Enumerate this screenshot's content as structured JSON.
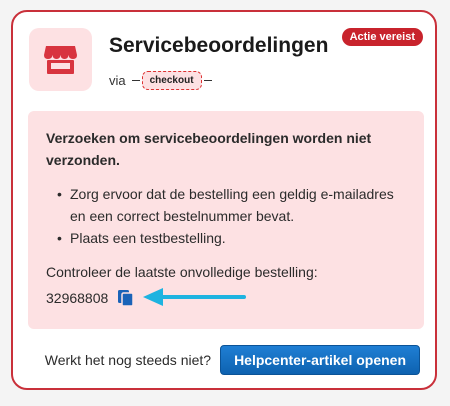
{
  "badge": "Actie vereist",
  "title": "Servicebeoordelingen",
  "via_label": "via",
  "source_tag": "checkout",
  "alert": {
    "heading": "Verzoeken om servicebeoordelingen worden niet verzonden.",
    "bullets": [
      "Zorg ervoor dat de bestelling een geldig e-mailadres en een correct bestelnummer bevat.",
      "Plaats een testbestelling."
    ],
    "order_label": "Controleer de laatste onvolledige bestelling:",
    "order_number": "32968808"
  },
  "footer": {
    "question": "Werkt het nog steeds niet?",
    "button": "Helpcenter-artikel openen"
  },
  "icons": {
    "store": "storefront-icon",
    "copy": "copy-icon",
    "arrow": "arrow-left-icon"
  },
  "colors": {
    "accent": "#c8232c",
    "alert_bg": "#fde1e3",
    "button": "#1470c4",
    "arrow": "#1eb3e0"
  }
}
